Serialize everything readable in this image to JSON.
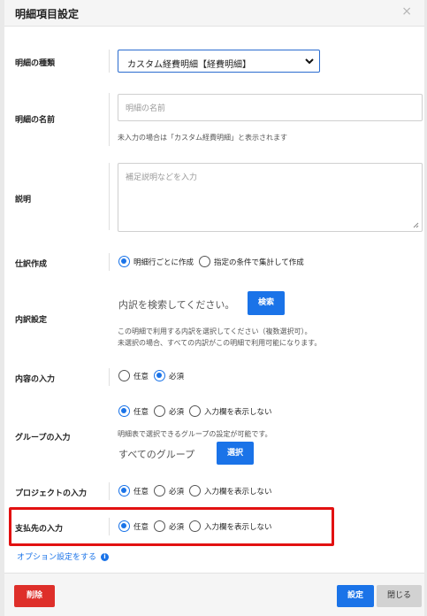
{
  "header": {
    "title": "明細項目設定",
    "close_icon": "×"
  },
  "fields": {
    "type": {
      "label": "明細の種類",
      "value": "カスタム経費明細【経費明細】"
    },
    "name": {
      "label": "明細の名前",
      "placeholder": "明細の名前",
      "hint": "未入力の場合は「カスタム経費明細」と表示されます"
    },
    "description": {
      "label": "説明",
      "placeholder": "補足説明などを入力"
    },
    "journal": {
      "label": "仕訳作成",
      "options": [
        "明細行ごとに作成",
        "指定の条件で集計して作成"
      ],
      "selected": 0
    },
    "breakdown": {
      "label": "内訳設定",
      "text": "内訳を検索してください。",
      "button": "検索",
      "hint1": "この明細で利用する内訳を選択してください（複数選択可）。",
      "hint2": "未選択の場合、すべての内訳がこの明細で利用可能になります。"
    },
    "content_input": {
      "label": "内容の入力",
      "options": [
        "任意",
        "必須"
      ],
      "selected": 1
    },
    "group_input": {
      "label": "グループの入力",
      "options": [
        "任意",
        "必須",
        "入力欄を表示しない"
      ],
      "selected": 0,
      "hint": "明細表で選択できるグループの設定が可能です。",
      "text": "すべてのグループ",
      "button": "選択"
    },
    "project_input": {
      "label": "プロジェクトの入力",
      "options": [
        "任意",
        "必須",
        "入力欄を表示しない"
      ],
      "selected": 0
    },
    "payee_input": {
      "label": "支払先の入力",
      "options": [
        "任意",
        "必須",
        "入力欄を表示しない"
      ],
      "selected": 0
    }
  },
  "option_link": "オプション設定をする",
  "footer": {
    "delete": "削除",
    "save": "設定",
    "close": "閉じる"
  },
  "colors": {
    "accent": "#1a73e8",
    "danger": "#de2f2a",
    "highlight": "#e21111"
  }
}
